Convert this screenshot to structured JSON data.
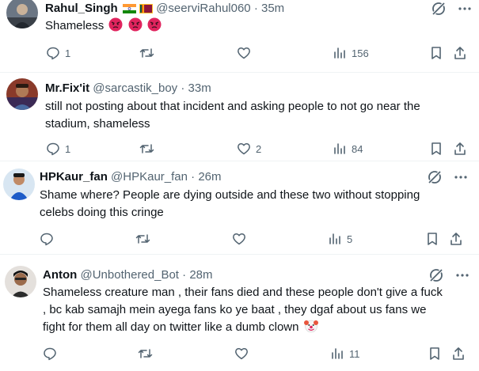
{
  "tweets": [
    {
      "name": "Rahul_Singh",
      "handle": "@seerviRahul060",
      "time": "35m",
      "sep": "·",
      "text": "Shameless",
      "emojis": [
        "angry-face",
        "angry-face",
        "angry-face"
      ],
      "replies": "1",
      "reposts": "",
      "likes": "",
      "views": "156"
    },
    {
      "name": "Mr.Fix'it",
      "handle": "@sarcastik_boy",
      "time": "33m",
      "sep": "·",
      "text_lines": [
        "still not posting about that incident and asking people to not go near the",
        "stadium, shameless"
      ],
      "replies": "1",
      "reposts": "",
      "likes": "2",
      "views": "84"
    },
    {
      "name": "HPKaur_fan",
      "handle": "@HPKaur_fan",
      "time": "26m",
      "sep": "·",
      "text_lines": [
        "Shame where? People are dying outside and these two without stopping",
        "celebs doing this cringe"
      ],
      "replies": "",
      "reposts": "",
      "likes": "",
      "views": "5"
    },
    {
      "name": "Anton",
      "handle": "@Unbothered_Bot",
      "time": "28m",
      "sep": "·",
      "text_lines": [
        "Shameless creature man , their fans died and these people don't give a fuck",
        ", bc kab samajh mein ayega fans ko ye baat , they dgaf about us fans we",
        "fight for them all day on twitter like a dumb clown"
      ],
      "emojis": [
        "clown-face"
      ],
      "replies": "",
      "reposts": "",
      "likes": "",
      "views": "11"
    }
  ],
  "colors": {
    "text": "#0f1419",
    "muted": "#536471",
    "divider": "#eff3f4",
    "angry": "#e0245e"
  }
}
